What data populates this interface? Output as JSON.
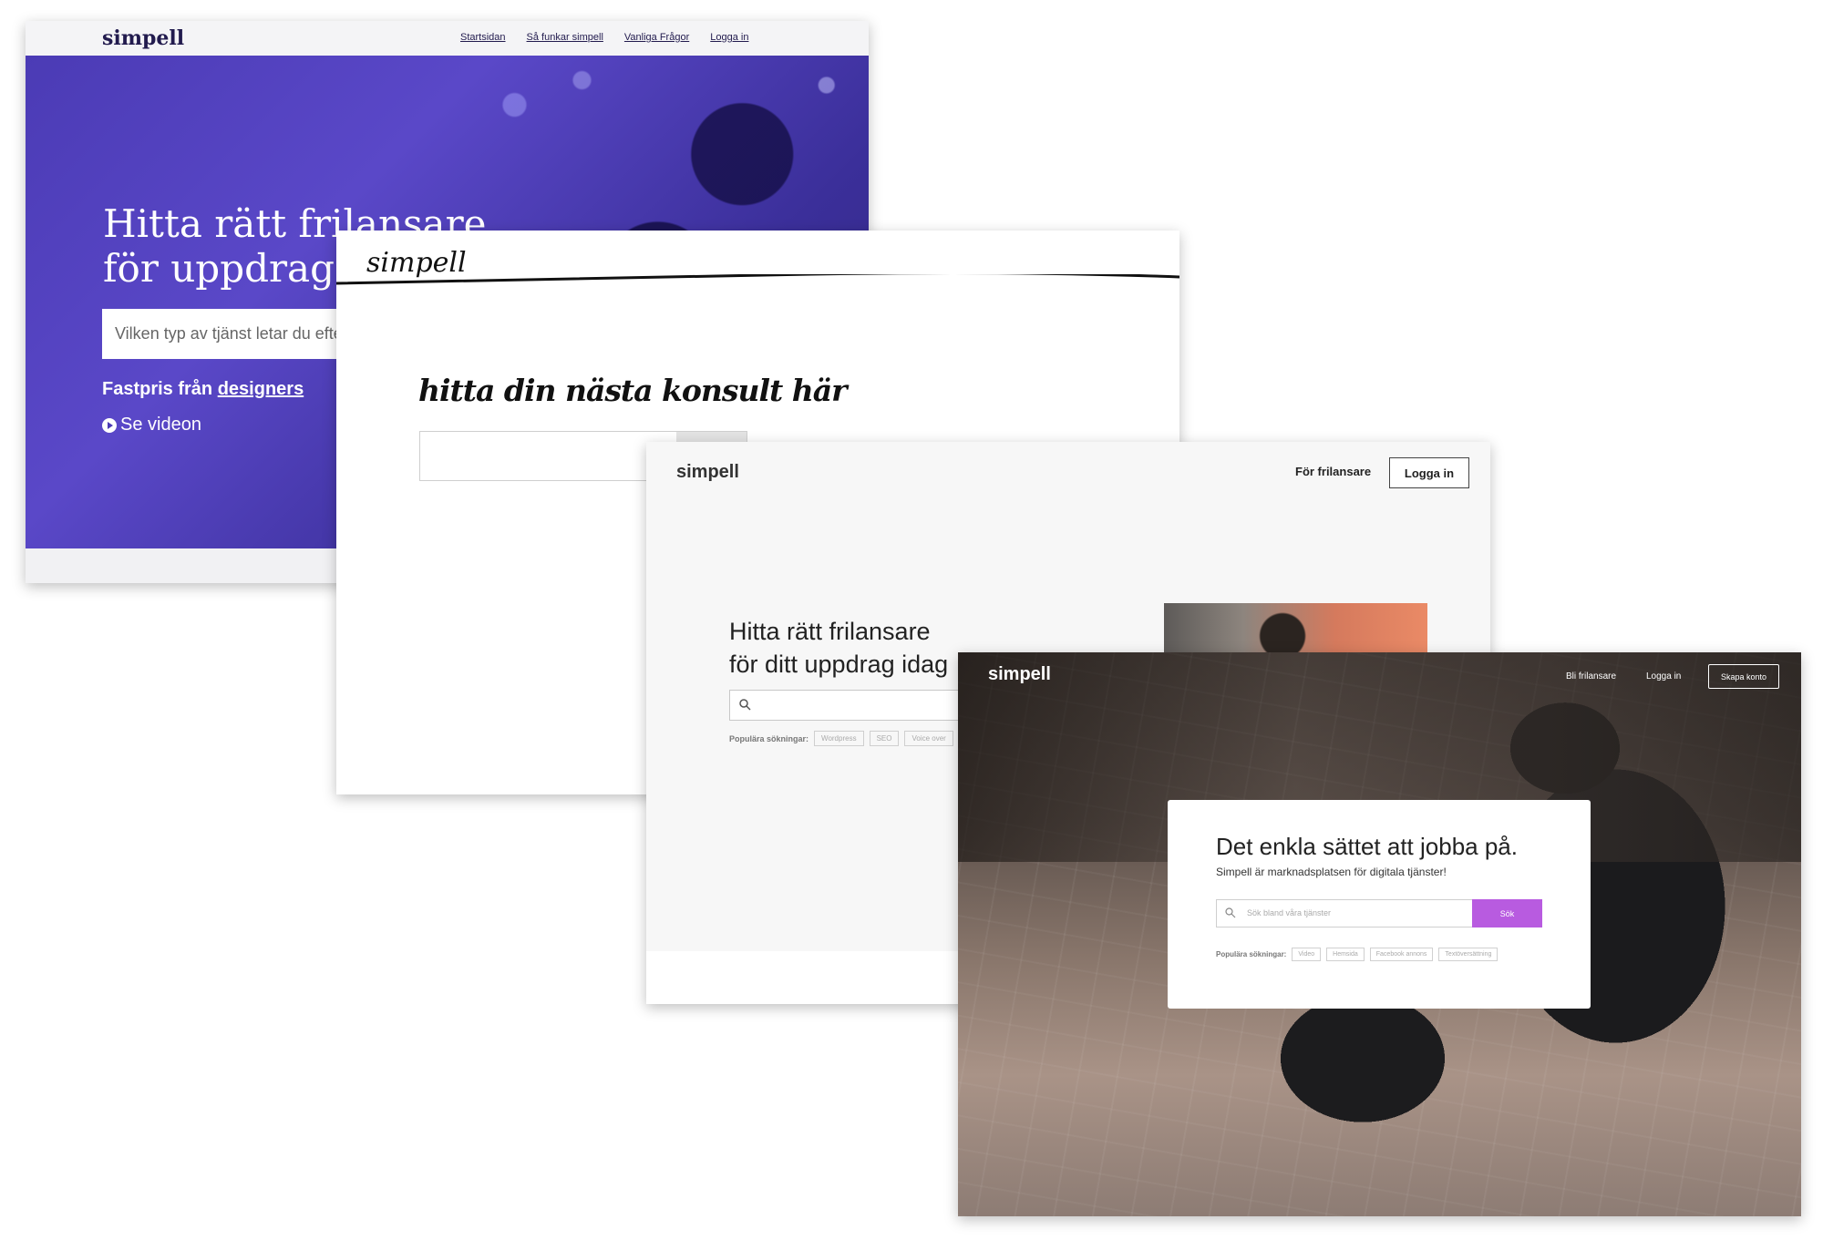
{
  "card1": {
    "logo": "simpell",
    "nav": [
      "Startsidan",
      "Så funkar simpell",
      "Vanliga Frågor",
      "Logga in"
    ],
    "headline": "Hitta rätt frilansare\nför uppdraget",
    "search_placeholder": "Vilken typ av tjänst letar du efter?",
    "fastpris_prefix": "Fastpris från ",
    "fastpris_link": "designers",
    "video_label": "Se videon",
    "accent_color": "#4b3bb5"
  },
  "card2": {
    "logo": "simpell",
    "tagline": "hitta din nästa konsult här"
  },
  "card3": {
    "logo": "simpell",
    "nav_freelancer": "För frilansare",
    "login_button": "Logga in",
    "headline": "Hitta rätt frilansare\nför ditt uppdrag idag",
    "popular_label": "Populära sökningar:",
    "popular_chips": [
      "Wordpress",
      "SEO",
      "Voice over"
    ]
  },
  "card4": {
    "logo": "simpell",
    "nav_become_freelancer": "Bli frilansare",
    "nav_login": "Logga in",
    "create_account": "Skapa konto",
    "headline": "Det enkla sättet att jobba på.",
    "subheadline": "Simpell är marknadsplatsen för digitala tjänster!",
    "search_placeholder": "Sök bland våra tjänster",
    "search_button": "Sök",
    "popular_label": "Populära sökningar:",
    "popular_chips": [
      "Video",
      "Hemsida",
      "Facebook annons",
      "Textöversättning"
    ],
    "accent_color": "#b85be0"
  }
}
